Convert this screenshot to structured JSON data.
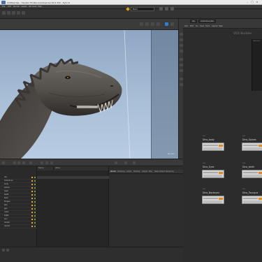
{
  "window": {
    "title": "Untitled.hip - Houdini FX Non-Commercial 20.5.332 - Py3.11"
  },
  "menubar": {
    "items": [
      "File",
      "Edit",
      "Render",
      "Assets",
      "Windows",
      "Help"
    ]
  },
  "toolbar": {
    "context_label": "Build",
    "shelf_tabs": [
      "Create",
      "Modify",
      "Model",
      "Polygon",
      "Deform",
      "Texture",
      "Rigging",
      "Characters",
      "Constraints",
      "Guide Process",
      "Terrain FX",
      "Simple FX",
      "Volume"
    ]
  },
  "network": {
    "path": "obj",
    "sub_path": "Indominus_Rex",
    "menu": [
      "Add",
      "Edit",
      "Go",
      "View",
      "Tools",
      "Layout",
      "Help"
    ],
    "title": "VEX Builder",
    "side_panel_title": "Indominus"
  },
  "nodes": [
    {
      "label": "Dino_body",
      "sub": "file1"
    },
    {
      "label": "Dino_Spines",
      "sub": "file2"
    },
    {
      "label": "Dino_Eyes",
      "sub": "file3"
    },
    {
      "label": "Dino_teeth",
      "sub": "file4"
    },
    {
      "label": "Dino_Backeyes",
      "sub": "file5"
    },
    {
      "label": "Dino_Toungue",
      "sub": "file6"
    }
  ],
  "tree": {
    "columns": [
      "Name",
      "Value"
    ],
    "rows": [
      "obj",
      "Indominus",
      "body",
      "spines",
      "eyes",
      "teeth",
      "back",
      "tongue",
      "skin",
      "geo",
      "cam1",
      "lights",
      "env",
      "render",
      "ropnet"
    ]
  },
  "properties": {
    "tabs": [
      "Render",
      "Sampling",
      "Limits",
      "Shading",
      "Output",
      "Misc",
      "Deep Output",
      "Rendering"
    ],
    "active_tab": "Render"
  },
  "viewport": {
    "camera_label": "No cam"
  }
}
